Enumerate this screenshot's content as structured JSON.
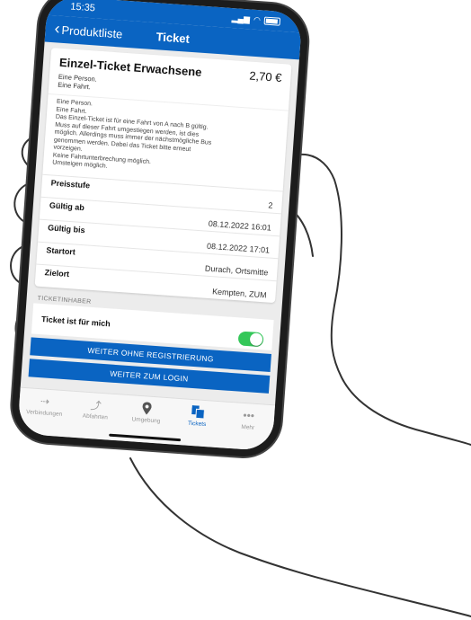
{
  "status_bar": {
    "time": "15:35"
  },
  "nav": {
    "back_label": "Produktliste",
    "title": "Ticket"
  },
  "ticket": {
    "name": "Einzel-Ticket Erwachsene",
    "price": "2,70 €",
    "subtitle_lines": [
      "Eine Person.",
      "Eine Fahrt."
    ],
    "description_lines": [
      "Eine Person.",
      "Eine Fahrt.",
      "Das Einzel-Ticket ist für eine Fahrt von A nach B gültig.",
      "Muss auf dieser Fahrt umgestiegen werden, ist dies",
      "möglich. Allerdings muss immer der nächstmögliche Bus",
      "genommen werden. Dabei das Ticket bitte erneut",
      "vorzeigen.",
      "Keine Fahrtunterbrechung möglich.",
      "Umsteigen möglich."
    ],
    "details": [
      {
        "label": "Preisstufe",
        "value": "2"
      },
      {
        "label": "Gültig ab",
        "value": "08.12.2022 16:01"
      },
      {
        "label": "Gültig bis",
        "value": "08.12.2022 17:01"
      },
      {
        "label": "Startort",
        "value": "Durach, Ortsmitte"
      },
      {
        "label": "Zielort",
        "value": "Kempten, ZUM"
      }
    ]
  },
  "holder": {
    "section_title": "TICKETINHABER",
    "toggle_label": "Ticket ist für mich",
    "toggle_on": true
  },
  "buttons": {
    "no_registration": "WEITER OHNE REGISTRIERUNG",
    "login": "WEITER ZUM LOGIN"
  },
  "tabs": [
    {
      "label": "Verbindungen",
      "icon": "connections-icon"
    },
    {
      "label": "Abfahrten",
      "icon": "departures-icon"
    },
    {
      "label": "Umgebung",
      "icon": "location-pin-icon"
    },
    {
      "label": "Tickets",
      "icon": "tickets-icon",
      "active": true
    },
    {
      "label": "Mehr",
      "icon": "more-dots-icon"
    }
  ],
  "colors": {
    "brand_blue": "#0a64c2",
    "toggle_green": "#34c759"
  }
}
